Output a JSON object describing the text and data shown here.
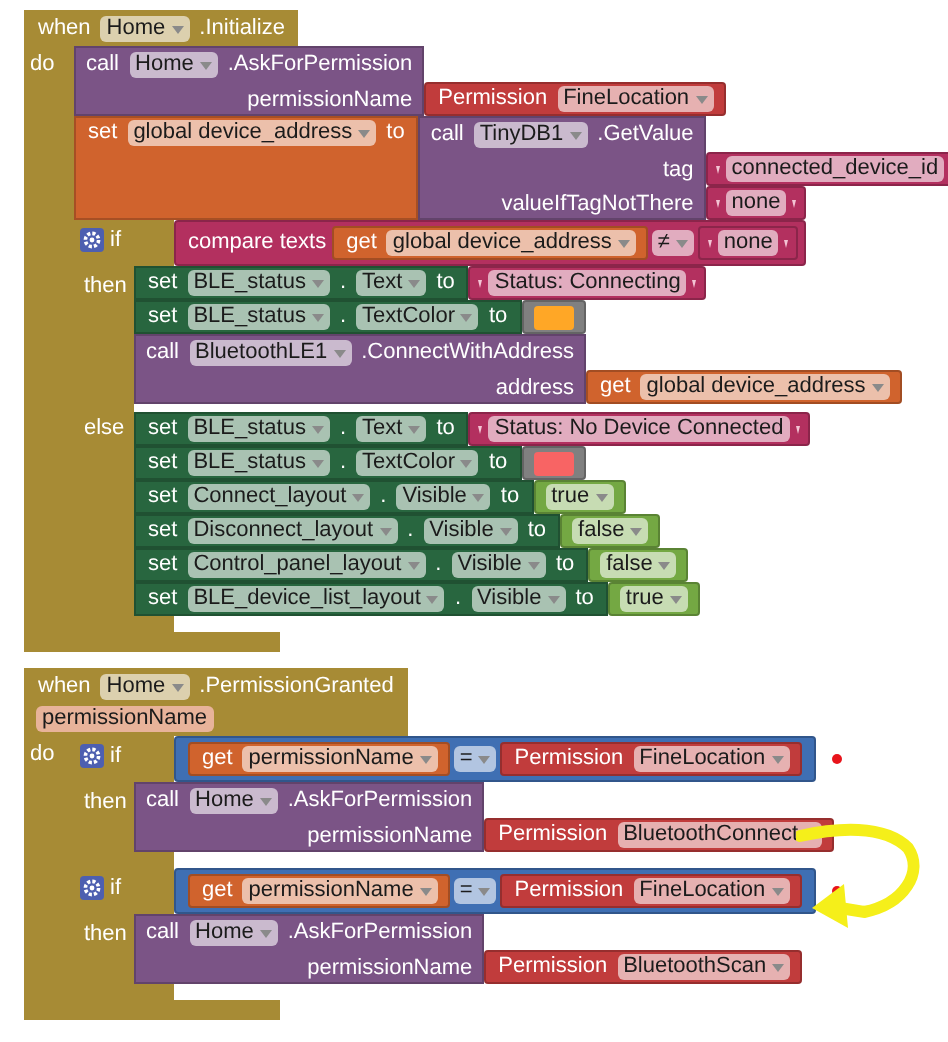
{
  "events": [
    {
      "keyword": "when",
      "component": "Home",
      "event": ".Initialize",
      "do_label": "do",
      "body": [
        {
          "kind": "call",
          "keyword": "call",
          "component": "Home",
          "method": ".AskForPermission",
          "args": [
            {
              "name": "permissionName",
              "value": {
                "kind": "permission",
                "label": "Permission",
                "option": "FineLocation"
              }
            }
          ]
        },
        {
          "kind": "set_global",
          "keyword": "set",
          "variable": "global device_address",
          "to": "to",
          "value": {
            "kind": "call",
            "keyword": "call",
            "component": "TinyDB1",
            "method": ".GetValue",
            "args": [
              {
                "name": "tag",
                "value": {
                  "kind": "text",
                  "text": "connected_device_id"
                }
              },
              {
                "name": "valueIfTagNotThere",
                "value": {
                  "kind": "text",
                  "text": "none"
                }
              }
            ]
          }
        },
        {
          "kind": "if",
          "marked": false,
          "if_label": "if",
          "condition": {
            "kind": "compare",
            "label": "compare texts",
            "left": {
              "kind": "get",
              "keyword": "get",
              "variable": "global device_address"
            },
            "op": "≠",
            "right": {
              "kind": "text",
              "text": "none"
            }
          },
          "then_label": "then",
          "then": [
            {
              "kind": "set_prop",
              "keyword": "set",
              "component": "BLE_status",
              "dot": ".",
              "property": "Text",
              "to": "to",
              "value": {
                "kind": "text",
                "text": "Status: Connecting"
              }
            },
            {
              "kind": "set_prop",
              "keyword": "set",
              "component": "BLE_status",
              "dot": ".",
              "property": "TextColor",
              "to": "to",
              "value": {
                "kind": "color",
                "color": "#ffa726"
              }
            },
            {
              "kind": "call",
              "keyword": "call",
              "component": "BluetoothLE1",
              "method": ".ConnectWithAddress",
              "args": [
                {
                  "name": "address",
                  "value": {
                    "kind": "get",
                    "keyword": "get",
                    "variable": "global device_address"
                  }
                }
              ]
            }
          ],
          "else_label": "else",
          "else": [
            {
              "kind": "set_prop",
              "keyword": "set",
              "component": "BLE_status",
              "dot": ".",
              "property": "Text",
              "to": "to",
              "value": {
                "kind": "text",
                "text": "Status: No Device Connected"
              }
            },
            {
              "kind": "set_prop",
              "keyword": "set",
              "component": "BLE_status",
              "dot": ".",
              "property": "TextColor",
              "to": "to",
              "value": {
                "kind": "color",
                "color": "#f86464"
              }
            },
            {
              "kind": "set_prop",
              "keyword": "set",
              "component": "Connect_layout",
              "dot": ".",
              "property": "Visible",
              "to": "to",
              "value": {
                "kind": "bool",
                "value": "true"
              }
            },
            {
              "kind": "set_prop",
              "keyword": "set",
              "component": "Disconnect_layout",
              "dot": ".",
              "property": "Visible",
              "to": "to",
              "value": {
                "kind": "bool",
                "value": "false"
              }
            },
            {
              "kind": "set_prop",
              "keyword": "set",
              "component": "Control_panel_layout",
              "dot": ".",
              "property": "Visible",
              "to": "to",
              "value": {
                "kind": "bool",
                "value": "false"
              }
            },
            {
              "kind": "set_prop",
              "keyword": "set",
              "component": "BLE_device_list_layout",
              "dot": ".",
              "property": "Visible",
              "to": "to",
              "value": {
                "kind": "bool",
                "value": "true"
              }
            }
          ]
        }
      ]
    },
    {
      "keyword": "when",
      "component": "Home",
      "event": ".PermissionGranted",
      "params": [
        "permissionName"
      ],
      "do_label": "do",
      "arrow": true,
      "body": [
        {
          "kind": "if",
          "marked": true,
          "if_label": "if",
          "condition": {
            "kind": "equals",
            "left": {
              "kind": "get",
              "keyword": "get",
              "variable": "permissionName"
            },
            "op": "=",
            "right": {
              "kind": "permission",
              "label": "Permission",
              "option": "FineLocation"
            }
          },
          "then_label": "then",
          "then": [
            {
              "kind": "call",
              "keyword": "call",
              "component": "Home",
              "method": ".AskForPermission",
              "args": [
                {
                  "name": "permissionName",
                  "value": {
                    "kind": "permission",
                    "label": "Permission",
                    "option": "BluetoothConnect"
                  }
                }
              ]
            }
          ]
        },
        {
          "kind": "if",
          "marked": true,
          "if_label": "if",
          "condition": {
            "kind": "equals",
            "left": {
              "kind": "get",
              "keyword": "get",
              "variable": "permissionName"
            },
            "op": "=",
            "right": {
              "kind": "permission",
              "label": "Permission",
              "option": "FineLocation"
            }
          },
          "then_label": "then",
          "then": [
            {
              "kind": "call",
              "keyword": "call",
              "component": "Home",
              "method": ".AskForPermission",
              "args": [
                {
                  "name": "permissionName",
                  "value": {
                    "kind": "permission",
                    "label": "Permission",
                    "option": "BluetoothScan"
                  }
                }
              ]
            }
          ]
        }
      ]
    }
  ]
}
